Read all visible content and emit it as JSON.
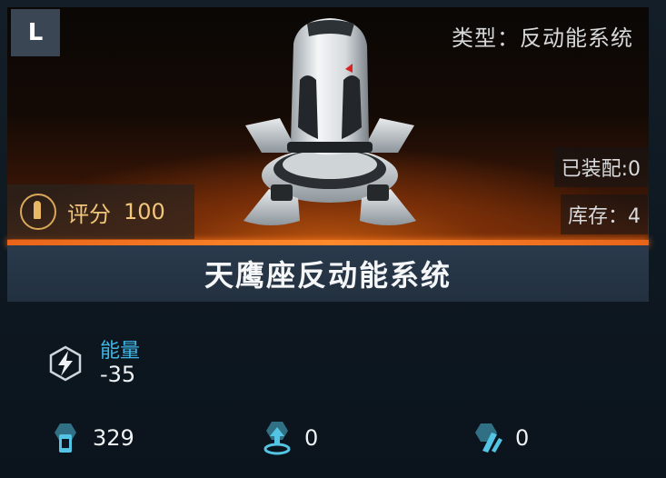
{
  "item": {
    "grade": "L",
    "type_label": "类型：反动能系统",
    "equipped_label": "已装配:0",
    "stock_label": "库存：4",
    "score_label": "评分",
    "score_value": "100",
    "name": "天鹰座反动能系统"
  },
  "energy": {
    "label": "能量",
    "value": "-35",
    "icon": "lightning-hexagon-icon"
  },
  "stats": [
    {
      "icon": "armor-module-icon",
      "value": "329"
    },
    {
      "icon": "shield-upgrade-icon",
      "value": "0"
    },
    {
      "icon": "speed-hex-icon",
      "value": "0"
    }
  ],
  "colors": {
    "accent_orange": "#ff8a2c",
    "score_gold": "#f1c57a",
    "energy_blue": "#3fb6e6",
    "badge_gray": "#3b4654"
  }
}
